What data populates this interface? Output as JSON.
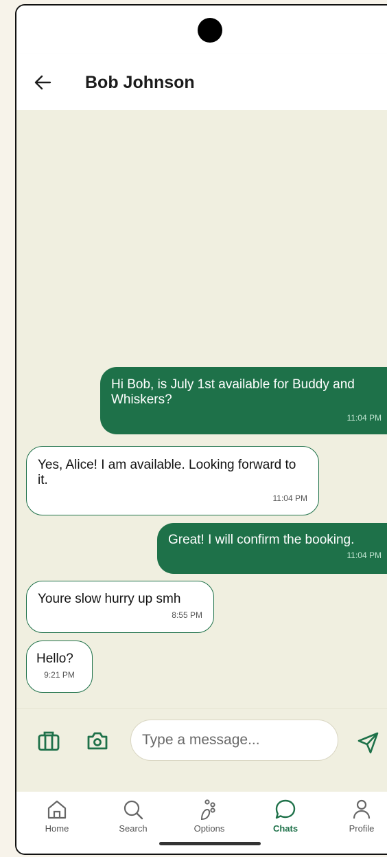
{
  "header": {
    "title": "Bob Johnson"
  },
  "messages": [
    {
      "direction": "outgoing",
      "text": "Hi Bob, is July 1st available for Buddy and Whiskers?",
      "time": "11:04 PM"
    },
    {
      "direction": "incoming",
      "text": "Yes, Alice! I am available. Looking forward to it.",
      "time": "11:04 PM"
    },
    {
      "direction": "outgoing",
      "text": "Great! I will confirm the booking.",
      "time": "11:04 PM"
    },
    {
      "direction": "incoming",
      "text": "Youre slow hurry up smh",
      "time": "8:55 PM"
    },
    {
      "direction": "incoming",
      "text": "Hello?",
      "time": "9:21 PM"
    }
  ],
  "composer": {
    "placeholder": "Type a message...",
    "value": "",
    "icons": [
      "briefcase-icon",
      "camera-icon",
      "send-icon"
    ]
  },
  "nav": {
    "items": [
      {
        "label": "Home",
        "icon": "home-icon"
      },
      {
        "label": "Search",
        "icon": "search-icon"
      },
      {
        "label": "Options",
        "icon": "paw-icon"
      },
      {
        "label": "Chats",
        "icon": "chat-icon",
        "active": true
      },
      {
        "label": "Profile",
        "icon": "profile-icon"
      }
    ]
  },
  "colors": {
    "accent": "#1e7149",
    "chat_background": "#f0efe0",
    "page_background": "#f7f3ea"
  }
}
